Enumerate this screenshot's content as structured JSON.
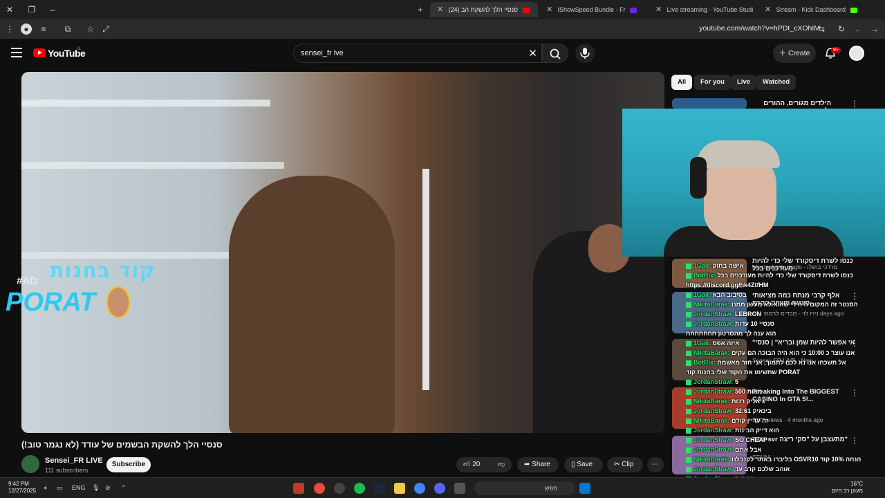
{
  "browser": {
    "tabs": [
      {
        "title": "סנסיי הלך להשקת הב (24)",
        "active": true,
        "favicon_color": "#ff0000"
      },
      {
        "title": "IShowSpeed Bundle - Fr",
        "active": false,
        "favicon_color": "#6d28d9"
      },
      {
        "title": "Live streaming - YouTube Studi",
        "active": false,
        "favicon_color": "#ff0000"
      },
      {
        "title": "Stream - Kick Dashboard",
        "active": false,
        "favicon_color": "#53fc18"
      }
    ],
    "new_tab_glyph": "+",
    "url": "youtube.com/watch?v=hPDt_cXOhIM"
  },
  "youtube": {
    "logo_text": "YouTube",
    "country": "IL",
    "search_value": "sensei_fr lve",
    "create_label": "Create",
    "notification_count": "9+",
    "accent": "#ff0000"
  },
  "video": {
    "title": "סנסיי הלך להשקת הבשמים של עודד (לא נגמר טוב!)",
    "promo_top": "קוד בחנות",
    "promo_ad": "#AD",
    "promo_brand": "PORAT",
    "channel_name": "Sensei_FR LIVE",
    "subscribers": "111 subscribers",
    "subscribe_label": "Subscribe",
    "like_count": "20",
    "share_label": "Share",
    "save_label": "Save",
    "clip_label": "Clip"
  },
  "filters": [
    {
      "label": "All",
      "active": true
    },
    {
      "label": "For you",
      "active": false
    },
    {
      "label": "Live",
      "active": false
    },
    {
      "label": "Watched",
      "active": false
    }
  ],
  "recommendations": [
    {
      "title": "הילדים מגורים, ההורים לחוצים:",
      "meta": "",
      "thumb_color": "#2d5b8c"
    },
    {
      "title": "כנסו לשרת דיסקורד שלי כדי להיות מעודכנים בכל",
      "meta": "Mordechai buzaglo - מרדכי בוזגלו",
      "thumb_color": "#7b5a40"
    },
    {
      "title": "אלף קרבי מנתח כמה מציאותי סצנות משחק הקרח",
      "meta": "נירו לוי - מבדים לרכוש · 13 days ago",
      "thumb_color": "#4b6a8a"
    },
    {
      "title": "\"אי אפשר להיות שמן ובריא\" | סנסי",
      "meta": "Sensei_FR LIVE · New",
      "thumb_color": "#5a4a3c"
    },
    {
      "title": "Breaking Into The BIGGEST CASINO In GTA 5!...",
      "meta": "327K views · 4 months ago",
      "thumb_color": "#a63c2c"
    },
    {
      "title": "עודד svr מתעצבן על \"סקי ריצה\"",
      "meta": "STAIM",
      "thumb_color": "#8a6a9c"
    }
  ],
  "chat": [
    {
      "user": "1Gali:",
      "text": "אישה בחוק"
    },
    {
      "user": "BotRix:",
      "text": "כנסו לשרת דיסקורד שלי כדי להיות מעודכנים בכל"
    },
    {
      "user": "",
      "text": "https://discord.gg/hk4ZtfHM"
    },
    {
      "user": "1Gali:",
      "text": "בסיבוב הבא"
    },
    {
      "user": "NikitaBarak:",
      "text": "הסנטר זה המקום היחידי שהוא לא מעשן ממנו"
    },
    {
      "user": "JordanStraw:",
      "text": "LEBRON"
    },
    {
      "user": "JordanStraw:",
      "text": "סנסיי 10 עדות"
    },
    {
      "user": "",
      "text": "הוא ענה לך מהסרטון חחחחחחח"
    },
    {
      "user": "1Gali:",
      "text": "איזה אפס"
    },
    {
      "user": "NikitaBarak:",
      "text": "אנו עוצר כ 10:00 כי הוא היה הבוכה הם עקים"
    },
    {
      "user": "BotRix:",
      "text": "אל תשכחו אנו נא לכם לתמוך, אני חזר מאשמח"
    },
    {
      "user": "",
      "text": "שתשימו את הקוד שלי בחנות קוד PORAT"
    },
    {
      "user": "JordanStraw:",
      "text": "5"
    },
    {
      "user": "JordanStraw:",
      "text": "מאות 500"
    },
    {
      "user": "NikitaBarak:",
      "text": "גיאליק רכות"
    },
    {
      "user": "JordanStraw:",
      "text": "32:61 בינאיק"
    },
    {
      "user": "NikitaBarak:",
      "text": "זה עדיין קודם"
    },
    {
      "user": "JordanStraw:",
      "text": "הוא דייק הבינות"
    },
    {
      "user": "JordanStraw:",
      "text": "SO CHEAP"
    },
    {
      "user": "JordanStraw:",
      "text": "אבל אתם"
    },
    {
      "user": "NikitaBarak:",
      "text": "בליברו באתר לקנבלנו OSVR10 הנחה 10% קוד"
    },
    {
      "user": "JordanStraw:",
      "text": "אוהב שלכם קרב עד"
    },
    {
      "user": "JordanStraw:",
      "text": "אנ קיס"
    }
  ],
  "taskbar": {
    "time": "9:42 PM",
    "date": "12/27/2025",
    "language": "ENG",
    "search_placeholder": "חפש",
    "temperature": "16°C",
    "weather_text": "מעונן רב היום"
  }
}
